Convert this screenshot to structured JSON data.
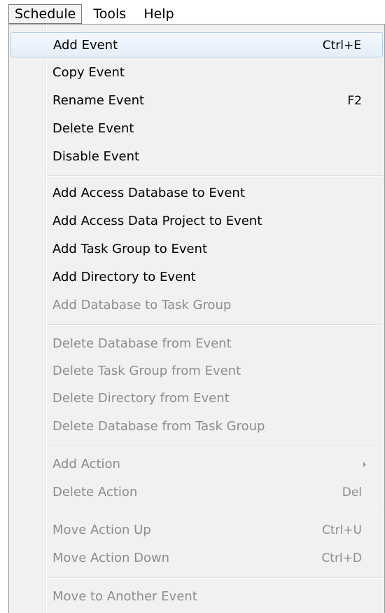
{
  "menubar": {
    "items": [
      {
        "label": "Schedule"
      },
      {
        "label": "Tools"
      },
      {
        "label": "Help"
      }
    ]
  },
  "menu": {
    "items": [
      {
        "label": "Add Event",
        "shortcut": "Ctrl+E"
      },
      {
        "label": "Copy Event",
        "shortcut": ""
      },
      {
        "label": "Rename Event",
        "shortcut": "F2"
      },
      {
        "label": "Delete Event",
        "shortcut": ""
      },
      {
        "label": "Disable Event",
        "shortcut": ""
      },
      {
        "label": "Add Access Database to Event",
        "shortcut": ""
      },
      {
        "label": "Add Access Data Project to Event",
        "shortcut": ""
      },
      {
        "label": "Add Task Group to Event",
        "shortcut": ""
      },
      {
        "label": "Add Directory to Event",
        "shortcut": ""
      },
      {
        "label": "Add Database to Task Group",
        "shortcut": ""
      },
      {
        "label": "Delete Database from Event",
        "shortcut": ""
      },
      {
        "label": "Delete Task Group from Event",
        "shortcut": ""
      },
      {
        "label": "Delete Directory from Event",
        "shortcut": ""
      },
      {
        "label": "Delete Database from Task Group",
        "shortcut": ""
      },
      {
        "label": "Add Action",
        "shortcut": ""
      },
      {
        "label": "Delete Action",
        "shortcut": "Del"
      },
      {
        "label": "Move Action Up",
        "shortcut": "Ctrl+U"
      },
      {
        "label": "Move Action Down",
        "shortcut": "Ctrl+D"
      },
      {
        "label": "Move to Another Event",
        "shortcut": ""
      }
    ]
  },
  "colors": {
    "highlight_border": "#b6cde8",
    "menu_background": "#f1f1f1",
    "disabled_text": "#8d8d8d"
  }
}
